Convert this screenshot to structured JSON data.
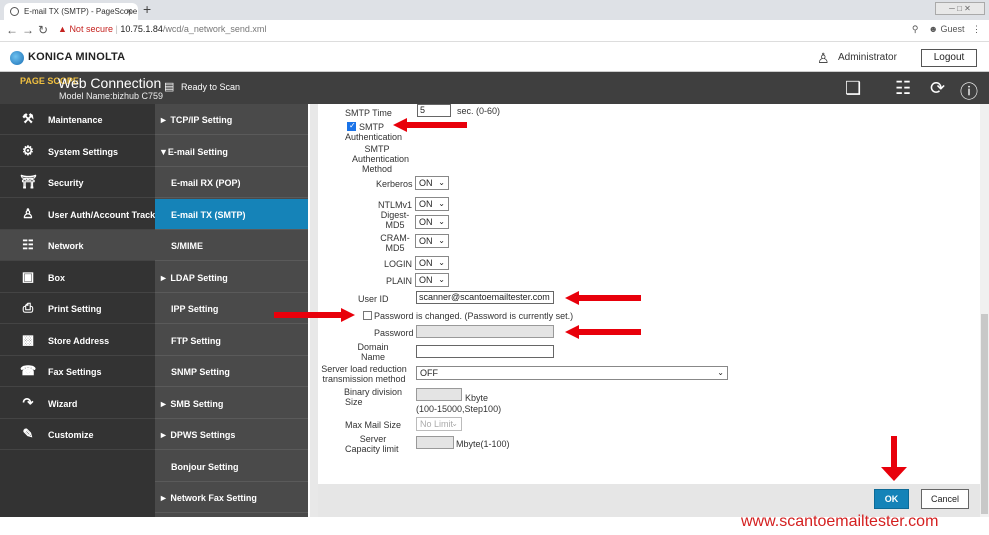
{
  "browser": {
    "tab_title": "E-mail TX (SMTP) - PageScope Web",
    "tab_close": "×",
    "new_tab": "+",
    "security_label": "Not secure",
    "url_host": "10.75.1.84",
    "url_path": "/wcd/a_network_send.xml",
    "profile": "Guest"
  },
  "header": {
    "brand": "KONICA MINOLTA",
    "user": "Administrator",
    "logout_label": "Logout"
  },
  "toolbar": {
    "product_logo": "PAGE SCOPE",
    "product_title": "Web Connection",
    "model": "Model Name:bizhub C759",
    "status": "Ready to Scan"
  },
  "sidebar": {
    "items": [
      {
        "label": "Maintenance",
        "icon": "wrench-icon"
      },
      {
        "label": "System Settings",
        "icon": "system-settings-icon"
      },
      {
        "label": "Security",
        "icon": "shield-icon"
      },
      {
        "label": "User Auth/Account Track",
        "icon": "user-auth-icon"
      },
      {
        "label": "Network",
        "icon": "network-icon"
      },
      {
        "label": "Box",
        "icon": "box-icon"
      },
      {
        "label": "Print Setting",
        "icon": "print-icon"
      },
      {
        "label": "Store Address",
        "icon": "address-icon"
      },
      {
        "label": "Fax Settings",
        "icon": "fax-icon"
      },
      {
        "label": "Wizard",
        "icon": "wizard-icon"
      },
      {
        "label": "Customize",
        "icon": "customize-icon"
      }
    ]
  },
  "submenu": {
    "items": [
      {
        "label": "► TCP/IP Setting"
      },
      {
        "label": "▼E-mail Setting"
      },
      {
        "label": "E-mail RX (POP)"
      },
      {
        "label": "E-mail TX (SMTP)"
      },
      {
        "label": "S/MIME"
      },
      {
        "label": "► LDAP Setting"
      },
      {
        "label": "IPP Setting"
      },
      {
        "label": "FTP Setting"
      },
      {
        "label": "SNMP Setting"
      },
      {
        "label": "► SMB Setting"
      },
      {
        "label": "► DPWS Settings"
      },
      {
        "label": "Bonjour Setting"
      },
      {
        "label": "► Network Fax Setting"
      }
    ]
  },
  "form": {
    "smtp_time_label": "SMTP Time",
    "smtp_time_value": "5",
    "smtp_time_unit": "sec. (0-60)",
    "smtp_auth_label_1": "SMTP",
    "smtp_auth_label_2": "Authentication",
    "auth_method_1": "SMTP",
    "auth_method_2": "Authentication",
    "auth_method_3": "Method",
    "kerberos_label": "Kerberos",
    "kerberos_value": "ON",
    "ntlmv1_label": "NTLMv1",
    "ntlmv1_value": "ON",
    "digest_label_1": "Digest-",
    "digest_label_2": "MD5",
    "digest_value": "ON",
    "cram_label_1": "CRAM-",
    "cram_label_2": "MD5",
    "cram_value": "ON",
    "login_label": "LOGIN",
    "login_value": "ON",
    "plain_label": "PLAIN",
    "plain_value": "ON",
    "userid_label": "User ID",
    "userid_value": "scanner@scantoemailtester.com",
    "pwchanged_label": "Password is changed.  (Password is currently set.)",
    "password_label": "Password",
    "password_value": "",
    "domain_label_1": "Domain",
    "domain_label_2": "Name",
    "domain_value": "",
    "server_load_label_1": "Server load reduction",
    "server_load_label_2": "transmission method",
    "server_load_value": "OFF",
    "binary_label_1": "Binary division",
    "binary_label_2": "Size",
    "binary_unit": "Kbyte",
    "binary_range": "(100-15000,Step100)",
    "maxmail_label": "Max Mail Size",
    "maxmail_value": "No Limit",
    "capacity_label_1": "Server",
    "capacity_label_2": "Capacity limit",
    "capacity_unit": "Mbyte(1-100)"
  },
  "footer": {
    "ok_label": "OK",
    "cancel_label": "Cancel"
  },
  "watermark": "www.scantoemailtester.com",
  "colors": {
    "accent": "#1583b8",
    "sidebar": "#333333",
    "submenu": "#4a4a4a",
    "arrow": "#e8000b",
    "watermark": "#d42020"
  }
}
